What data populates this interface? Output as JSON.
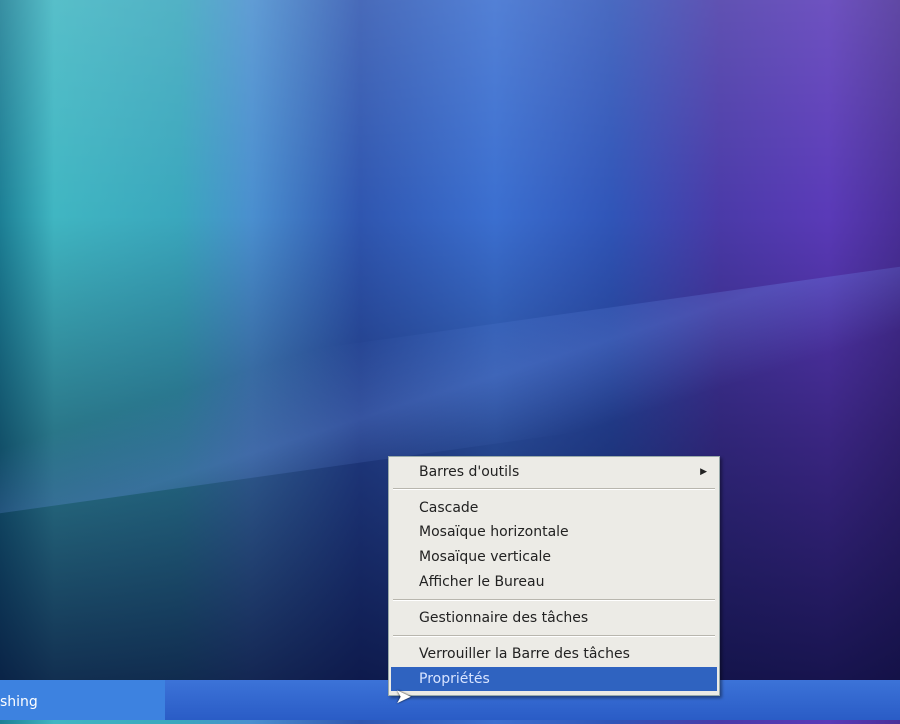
{
  "taskbar": {
    "task_label": "shing"
  },
  "context_menu": {
    "toolbars": "Barres d'outils",
    "cascade": "Cascade",
    "tile_horizontal": "Mosaïque horizontale",
    "tile_vertical": "Mosaïque verticale",
    "show_desktop": "Afficher le Bureau",
    "task_manager": "Gestionnaire des tâches",
    "lock_taskbar": "Verrouiller la Barre des tâches",
    "properties": "Propriétés"
  },
  "colors": {
    "highlight": "#2f63c0",
    "taskbar": "#2a5cc6"
  }
}
